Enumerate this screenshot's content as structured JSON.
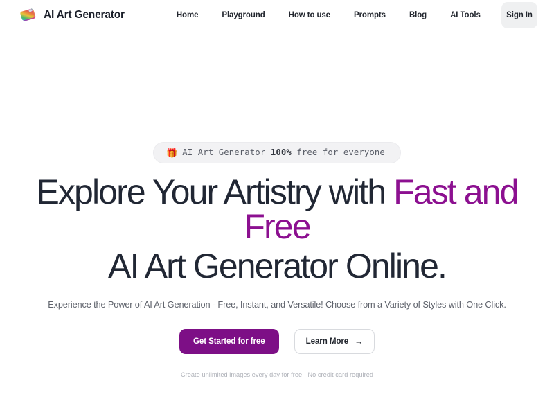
{
  "header": {
    "brand": {
      "logo_icon": "art-palette-icon",
      "name": "AI Art Generator"
    },
    "nav": [
      {
        "label": "Home"
      },
      {
        "label": "Playground"
      },
      {
        "label": "How to use"
      },
      {
        "label": "Prompts"
      },
      {
        "label": "Blog"
      },
      {
        "label": "AI Tools"
      }
    ],
    "signin_label": "Sign In"
  },
  "hero": {
    "badge": {
      "emoji": "🎁",
      "text_before": "AI Art Generator ",
      "text_strong": "100%",
      "text_after": " free for everyone"
    },
    "headline": {
      "line1_plain": "Explore Your Artistry with ",
      "line1_accent": "Fast and Free",
      "line2": "AI Art Generator Online."
    },
    "subtitle": "Experience the Power of AI Art Generation - Free, Instant, and Versatile! Choose from a Variety of Styles with One Click.",
    "primary_cta": "Get Started for free",
    "secondary_cta": "Learn More",
    "secondary_cta_icon": "arrow-right-icon",
    "arrow_glyph": "→",
    "fineprint": "Create unlimited images every day for free · No credit card required"
  },
  "colors": {
    "accent_purple": "#8c1090",
    "primary_button": "#7d0f86",
    "heading": "#212734",
    "body_text": "#5f636c",
    "page_background": "#ffffff",
    "badge_background": "#f2f2f4",
    "signin_background": "#eff0f1"
  }
}
